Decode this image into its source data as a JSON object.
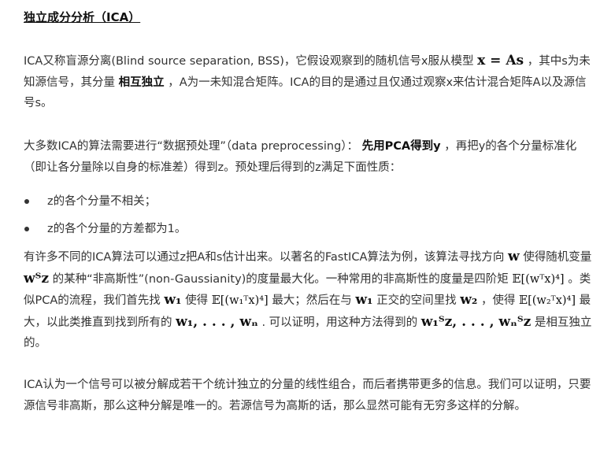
{
  "title": "独立成分分析（ICA）",
  "p1": {
    "t1": "ICA又称盲源分离(Blind source separation, BSS)，它假设观察到的随机信号x服从模型",
    "math_model": "x = As",
    "t2": "，其中s为未知源信号，其分量",
    "bold": "相互独立",
    "t3": "，A为一未知混合矩阵。ICA的目的是通过且仅通过观察x来估计混合矩阵A以及源信号s。"
  },
  "p2": {
    "t1": "大多数ICA的算法需要进行“数据预处理”（data preprocessing）：",
    "bold": "先用PCA得到y",
    "t2": "，再把y的各个分量标准化（即让各分量除以自身的标准差）得到z。预处理后得到的z满足下面性质："
  },
  "bullets": [
    "z的各个分量不相关；",
    "z的各个分量的方差都为1。"
  ],
  "p3": {
    "t1": "有许多不同的ICA算法可以通过z把A和s估计出来。以著名的FastICA算法为例，该算法寻找方向",
    "m_w": "w",
    "t2": "使得随机变量",
    "m_wtz": "wᵀz",
    "t3": "的某种“非高斯性”(non-Gaussianity)的度量最大化。一种常用的非高斯性的度量是四阶矩",
    "m_e4": "𝔼[(wᵀx)⁴]",
    "t4": "。类似PCA的流程，我们首先找",
    "m_w1": "w₁",
    "t5": "使得",
    "m_e1": "𝔼[(w₁ᵀx)⁴]",
    "t6": "最大；然后在与",
    "m_w1b": "w₁",
    "t7": "正交的空间里找",
    "m_w2": "w₂",
    "t8": "，使得",
    "m_e2": "𝔼[(w₂ᵀx)⁴]",
    "t9": "最大，以此类推直到找到所有的",
    "m_ws": "w₁, . . . , wₙ",
    "t10": ". 可以证明，用这种方法得到的",
    "m_zs": "w₁ᵀz, . . . , wₙᵀz",
    "t11": "是相互独立的。"
  },
  "p4": "ICA认为一个信号可以被分解成若干个统计独立的分量的线性组合，而后者携带更多的信息。我们可以证明，只要源信号非高斯，那么这种分解是唯一的。若源信号为高斯的话，那么显然可能有无穷多这样的分解。"
}
